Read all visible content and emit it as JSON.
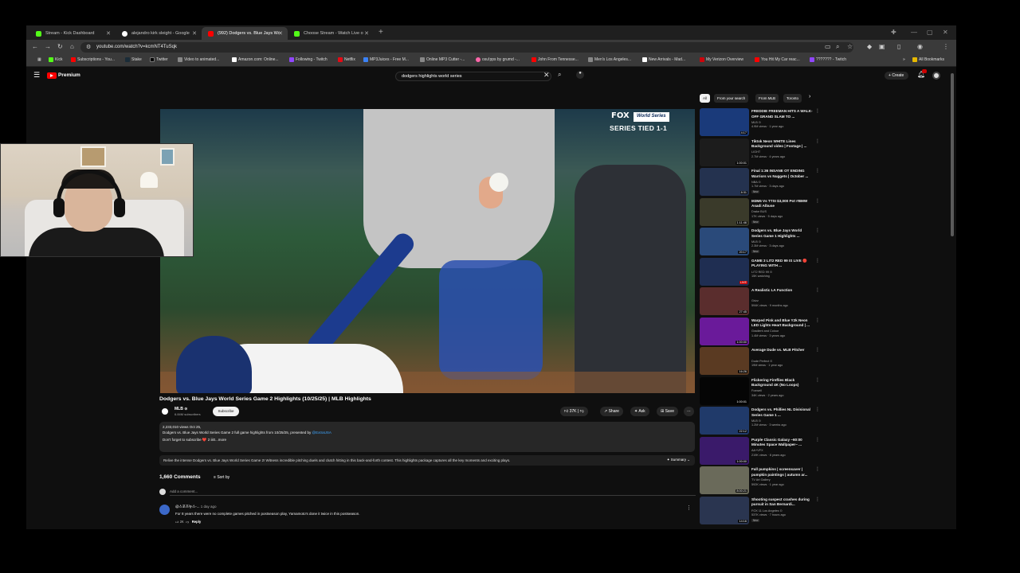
{
  "browser": {
    "tabs": [
      {
        "label": "Stream - Kick Dashboard",
        "color": "#53fc18"
      },
      {
        "label": "alejandro kirk sleight - Google",
        "color": "#ffffff"
      },
      {
        "label": "(992) Dodgers vs. Blue Jays Wo",
        "color": "#ff0000"
      },
      {
        "label": "Choose Stream - Watch Live o",
        "color": "#53fc18"
      }
    ],
    "url": "youtube.com/watch?v=kcmNT4TuSqk",
    "bookmarks": [
      {
        "label": "Kick",
        "color": "#53fc18"
      },
      {
        "label": "Subscriptions - You...",
        "color": "#ff0000"
      },
      {
        "label": "Stake",
        "color": "#1a2c38"
      },
      {
        "label": "Twitter",
        "color": "#000000"
      },
      {
        "label": "Video to animated...",
        "color": "#888888"
      },
      {
        "label": "Amazon.com: Online...",
        "color": "#ffffff"
      },
      {
        "label": "Following - Twitch",
        "color": "#9146ff"
      },
      {
        "label": "Netflix",
        "color": "#e50914"
      },
      {
        "label": "MP3Juices - Free M...",
        "color": "#3b82f6"
      },
      {
        "label": "Online MP3 Cutter -...",
        "color": "#888888"
      },
      {
        "label": "osu!pps by grumd -...",
        "color": "#ff66aa"
      },
      {
        "label": "John From Tennesse...",
        "color": "#ff0000"
      },
      {
        "label": "Men's Los Angeles...",
        "color": "#888888"
      },
      {
        "label": "New Arrivals - Mad...",
        "color": "#ffffff"
      },
      {
        "label": "My Verizon Overview",
        "color": "#cd040b"
      },
      {
        "label": "You Hit My Car reac...",
        "color": "#ff0000"
      },
      {
        "label": "??????? - Twitch",
        "color": "#9146ff"
      }
    ],
    "all_bookmarks": "All Bookmarks"
  },
  "youtube": {
    "brand": "Premium",
    "search_query": "dodgers highlights world series",
    "create_label": "Create"
  },
  "player": {
    "network": "FOX",
    "event_logo": "World Series",
    "series_status": "SERIES TIED 1-1"
  },
  "video": {
    "title": "Dodgers vs. Blue Jays World Series Game 2 Highlights (10/25/25) | MLB Highlights",
    "channel": "MLB",
    "subscribers": "6.84M subscribers",
    "subscribe_label": "Subscribe",
    "likes": "37K",
    "share_label": "Share",
    "ask_label": "Ask",
    "save_label": "Save",
    "views_date": "2,233,010 views  Oct 25,",
    "description": "Dodgers vs. Blue Jays World Series Game 2 full game highlights from 10/25/25, presented by",
    "description_link": "@ExtraUSA",
    "description_more": "Don't forget to subscribe  ❤️ 2 iii0...more",
    "ai_summary": "Relive the intense Dodgers vs. Blue Jays World Series Game 2! Witness incredible pitching duels and clutch hitting in this back-and-forth contest. This highlights package captures all the key moments and exciting plays.",
    "summary_label": "✦ Summary ⌄"
  },
  "comments": {
    "count": "1,660 Comments",
    "sort_label": "Sort by",
    "add_placeholder": "Add a comment...",
    "first": {
      "author": "@스포츠뉴스-...",
      "time": "1 day ago",
      "text": "For 8 years there were no complete games pitched in postseason play, Yamamoto's done it twice in this postseason.",
      "likes": "2K",
      "reply_label": "Reply"
    }
  },
  "sidebar": {
    "chips": [
      "All",
      "From your search",
      "From MLB",
      "Toronto"
    ],
    "recs": [
      {
        "title": "FREDDIE FREEMAN HITS A WALK-OFF GRAND SLAM TO ...",
        "channel": "MLB ⊙",
        "meta": "4.9M views · 1 year ago",
        "dur": "4:17",
        "color": "#1a3a7a",
        "badge": ""
      },
      {
        "title": "Tiktok Neon WHITE Lines Background video | Footage | ...",
        "channel": "LIGHT",
        "meta": "2.7M views · 4 years ago",
        "dur": "1:00:01",
        "color": "#1c1c1c",
        "badge": ""
      },
      {
        "title": "Final 1:36 INSANE OT ENDING Warriors vs Nuggets | October ...",
        "channel": "NBA ⊙",
        "meta": "1.7M views · 3 days ago",
        "dur": "8:31",
        "color": "#24324f",
        "badge": "New"
      },
      {
        "title": "M3M6 Vs TTSI $3,000 Pot #BMW Asadi Albuse",
        "channel": "Drake BUS",
        "meta": "17K views · 5 days ago",
        "dur": "1:11:46",
        "color": "#3a3a2a",
        "badge": "New"
      },
      {
        "title": "Dodgers vs. Blue Jays World Series Game 1 Highlights ...",
        "channel": "MLB ⊙",
        "meta": "2.3M views · 3 days ago",
        "dur": "20:17",
        "color": "#2a4a7a",
        "badge": "New"
      },
      {
        "title": "GAME 3 LIT2 RED 99 IS LIVE 🔴 PLAYING WITH ...",
        "channel": "LIT2 RED 99 ⊙",
        "meta": "15K watching",
        "dur": "LIVE",
        "color": "#1f2e52",
        "badge": ""
      },
      {
        "title": "A Realistic LA Function",
        "channel": "Grizz",
        "meta": "594K views · 9 months ago",
        "dur": "27:45",
        "color": "#5a2d2d",
        "badge": ""
      },
      {
        "title": "Warped Pink and Blue Y2k Neon LED Lights Heart Background | ...",
        "channel": "Gradient and Colour",
        "meta": "1.4M views · 3 years ago",
        "dur": "1:00:00",
        "color": "#6a1a9a",
        "badge": ""
      },
      {
        "title": "Average Dude vs. MLB Pitcher",
        "channel": "Dude Perfect ⊙",
        "meta": "19M views · 1 year ago",
        "dur": "16:26",
        "color": "#5a3a22",
        "badge": ""
      },
      {
        "title": "Flickering Fireflies Black Background 4K (No Loops)",
        "channel": "Foxwell",
        "meta": "34K views · 2 years ago",
        "dur": "1:00:01",
        "color": "#050505",
        "badge": ""
      },
      {
        "title": "Dodgers vs. Phillies NL Divisional Series Game 1 ...",
        "channel": "MLB ⊙",
        "meta": "1.2M views · 3 weeks ago",
        "dur": "22:12",
        "color": "#203a6a",
        "badge": ""
      },
      {
        "title": "Purple Classic Galaxy ~60:00 Minutes Space Wallpaper~ ...",
        "channel": "AA+VFX",
        "meta": "219K views · 8 years ago",
        "dur": "1:00:00",
        "color": "#3a1a6a",
        "badge": ""
      },
      {
        "title": "Fall pumpkins | screensaver | pumpkin paintings | autumn ar...",
        "channel": "TV Art Gallery",
        "meta": "592K views · 1 year ago",
        "dur": "8:00:21",
        "color": "#6a6a5a",
        "badge": ""
      },
      {
        "title": "Shooting suspect crashes during pursuit in San Bernardi...",
        "channel": "FOX 11 Los Angeles ⊙",
        "meta": "537K views · 7 hours ago",
        "dur": "14:16",
        "color": "#2a3550",
        "badge": "New"
      }
    ]
  }
}
